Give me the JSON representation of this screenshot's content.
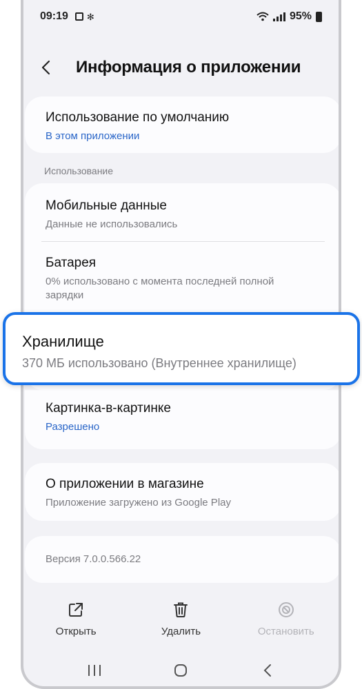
{
  "status_bar": {
    "time": "09:19",
    "battery": "95%",
    "icons": [
      "gallery-icon",
      "fan-icon",
      "wifi-icon",
      "signal-icon",
      "battery-icon"
    ]
  },
  "header": {
    "title": "Информация о приложении",
    "back_icon": "chevron-left-icon"
  },
  "default_use": {
    "title": "Использование по умолчанию",
    "subtitle": "В этом приложении"
  },
  "usage_section": {
    "label": "Использование",
    "mobile_data": {
      "title": "Мобильные данные",
      "subtitle": "Данные не использовались"
    },
    "battery": {
      "title": "Батарея",
      "subtitle": "0% использовано с момента последней полной зарядки"
    },
    "storage": {
      "title": "Хранилище",
      "subtitle": "370 МБ использовано (Внутреннее хранилище)"
    }
  },
  "pip": {
    "title": "Картинка-в-картинке",
    "subtitle": "Разрешено"
  },
  "store": {
    "title": "О приложении в магазине",
    "subtitle": "Приложение загружено из Google Play"
  },
  "version": {
    "text": "Версия 7.0.0.566.22"
  },
  "actions": {
    "open": "Открыть",
    "delete": "Удалить",
    "stop": "Остановить"
  },
  "colors": {
    "accent": "#1a73e8",
    "link": "#2a66c8",
    "background": "#f2f2f6",
    "card": "#fcfcfe"
  }
}
